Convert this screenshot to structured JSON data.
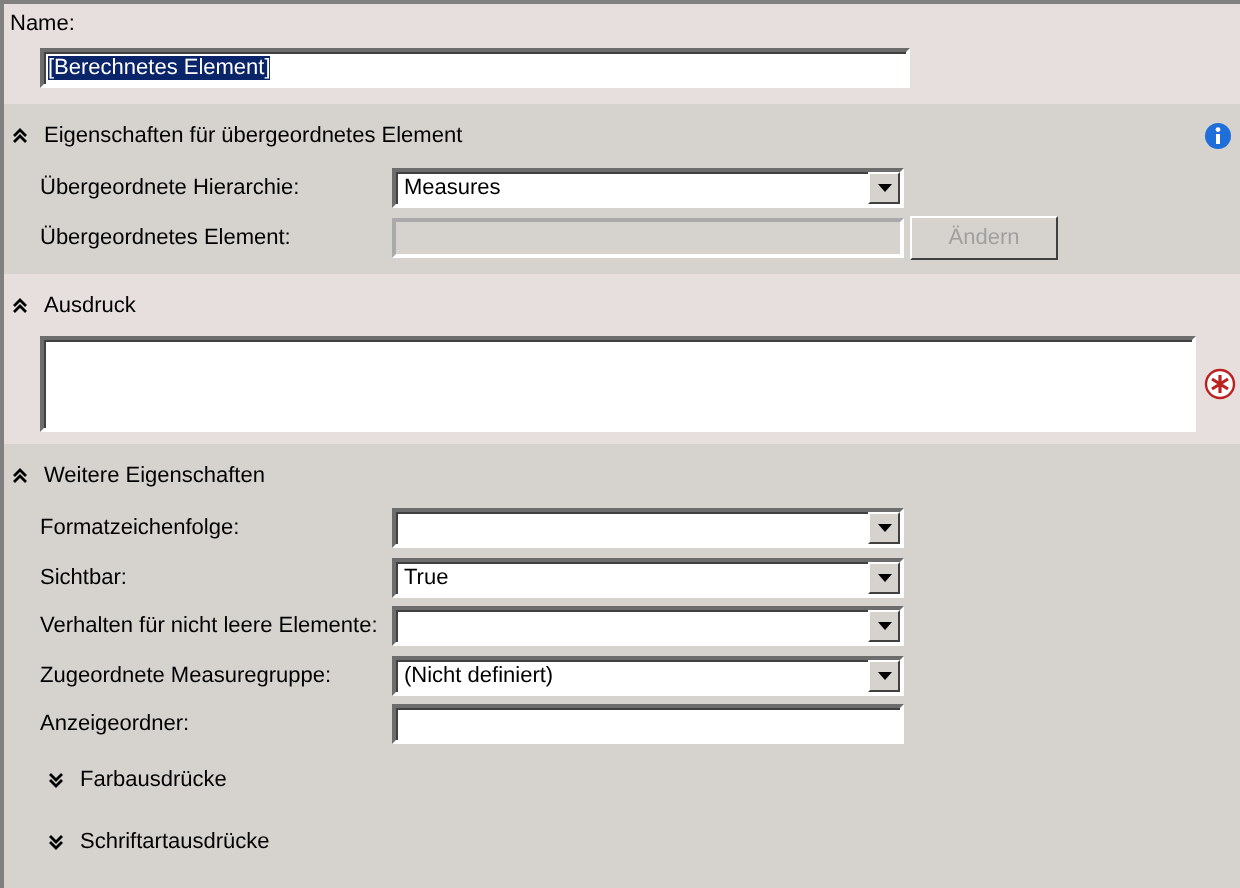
{
  "name_field": {
    "label": "Name:",
    "value": "[Berechnetes Element]",
    "text_selected": true
  },
  "sections": [
    {
      "title": "Eigenschaften für übergeordnetes Element",
      "expanded": true,
      "info": true,
      "rows": [
        {
          "kind": "dropdown",
          "label": "Übergeordnete Hierarchie:",
          "value": "Measures"
        },
        {
          "kind": "text",
          "label": "Übergeordnetes Element:",
          "disabled": true,
          "button": {
            "label": "Ändern",
            "disabled": true
          }
        }
      ]
    },
    {
      "title": "Ausdruck",
      "expanded": true,
      "expression_box": {
        "required": true
      }
    },
    {
      "title": "Weitere Eigenschaften",
      "expanded": true,
      "rows": [
        {
          "kind": "dropdown",
          "label": "Formatzeichenfolge:"
        },
        {
          "kind": "dropdown",
          "label": "Sichtbar:",
          "value": "True"
        },
        {
          "kind": "dropdown",
          "label": "Verhalten für nicht leere Elemente:"
        },
        {
          "kind": "dropdown",
          "label": "Zugeordnete Measuregruppe:",
          "value": "(Nicht definiert)"
        },
        {
          "kind": "text",
          "label": "Anzeigeordner:",
          "disabled": false
        }
      ],
      "subsections": [
        {
          "title": "Farbausdrücke",
          "expanded": false
        },
        {
          "title": "Schriftartausdrücke",
          "expanded": false
        }
      ]
    }
  ]
}
